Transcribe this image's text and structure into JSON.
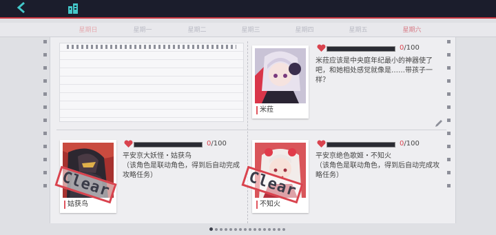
{
  "weekdays": {
    "sun": "星期日",
    "mon": "星期一",
    "tue": "星期二",
    "wed": "星期三",
    "thu": "星期四",
    "fri": "星期五",
    "sat": "星期六"
  },
  "entries": [
    {
      "name": "米菈",
      "score_current": "0",
      "score_total": "/100",
      "description": "米菈应该是中央庭年纪最小的神器使了吧，和她相处感觉就像是……带孩子一样？",
      "affection_level": 0
    },
    {
      "name": "姑获鸟",
      "score_current": "0",
      "score_total": "/100",
      "title": "平安京大妖怪・姑获鸟",
      "note": "（该角色是联动角色，得到后自动完成攻略任务）",
      "stamp": "Clear",
      "affection_level": 0
    },
    {
      "name": "不知火",
      "score_current": "0",
      "score_total": "/100",
      "title": "平安京绝色歌姬・不知火",
      "note": "（该角色是联动角色，得到后自动完成攻略任务）",
      "stamp": "Clear",
      "affection_level": 0
    }
  ],
  "pagination": {
    "total": 16,
    "current": 1
  },
  "colors": {
    "accent": "#d9434e",
    "topbar": "#1b1d2c",
    "back": "#43c7c9"
  }
}
